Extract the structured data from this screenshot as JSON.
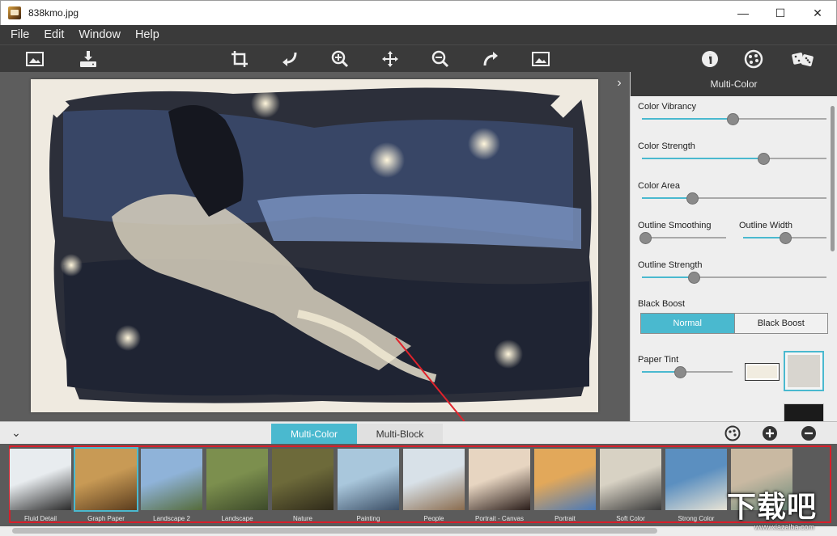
{
  "window": {
    "title": "838kmo.jpg",
    "controls": {
      "minimize": "—",
      "maximize": "☐",
      "close": "✕"
    }
  },
  "menu": [
    "File",
    "Edit",
    "Window",
    "Help"
  ],
  "toolbar": {
    "left": [
      "open-image-icon",
      "save-download-icon"
    ],
    "center": [
      "crop-icon",
      "undo-icon",
      "zoom-in-icon",
      "pan-move-icon",
      "zoom-out-icon",
      "redo-icon",
      "fit-image-icon"
    ],
    "right": [
      "info-icon",
      "palette-icon",
      "dice-random-icon"
    ]
  },
  "canvas": {
    "collapse_arrow": "›"
  },
  "panel": {
    "title": "Multi-Color",
    "controls": {
      "color_vibrancy": {
        "label": "Color Vibrancy",
        "value": 0.49
      },
      "color_strength": {
        "label": "Color Strength",
        "value": 0.66
      },
      "color_area": {
        "label": "Color Area",
        "value": 0.27
      },
      "outline_smoothing": {
        "label": "Outline Smoothing",
        "value": 0.0
      },
      "outline_width": {
        "label": "Outline Width",
        "value": 0.5
      },
      "outline_strength": {
        "label": "Outline Strength",
        "value": 0.28
      },
      "black_boost": {
        "label": "Black Boost",
        "options": [
          "Normal",
          "Black Boost"
        ],
        "selected": "Normal"
      },
      "paper_tint": {
        "label": "Paper Tint",
        "value": 0.42,
        "swatch_color": "#f1ece0"
      }
    }
  },
  "bottom_bar": {
    "collapse_arrow": "⌄",
    "tabs": [
      {
        "label": "Multi-Color",
        "active": true
      },
      {
        "label": "Multi-Block",
        "active": false
      }
    ],
    "icons": [
      "palette-small-icon",
      "add-preset-icon",
      "remove-preset-icon"
    ]
  },
  "presets": [
    {
      "label": "Fluid Detail",
      "selected": false
    },
    {
      "label": "Graph Paper",
      "selected": true
    },
    {
      "label": "Landscape 2",
      "selected": false
    },
    {
      "label": "Landscape",
      "selected": false
    },
    {
      "label": "Nature",
      "selected": false
    },
    {
      "label": "Painting",
      "selected": false
    },
    {
      "label": "People",
      "selected": false
    },
    {
      "label": "Portrait - Canvas",
      "selected": false
    },
    {
      "label": "Portrait",
      "selected": false
    },
    {
      "label": "Soft Color",
      "selected": false
    },
    {
      "label": "Strong Color",
      "selected": false
    },
    {
      "label": "",
      "selected": false
    }
  ],
  "watermark": {
    "big": "下载吧",
    "small": "www.xiazaiba.com"
  },
  "colors": {
    "accent": "#4ab9cf",
    "dark": "#3a3a3a",
    "highlight_frame": "#d81e2a",
    "arrow": "#e0222b"
  }
}
